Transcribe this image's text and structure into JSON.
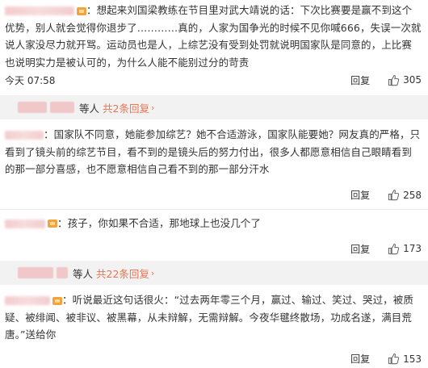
{
  "comments": [
    {
      "text": "：想起来刘国梁教练在节目里对武大靖说的话：下次比赛要是赢不到这个优势，别人就会觉得你退步了…………真的，人家为国争光的时候不见你喊666，失误一次就说人家没尽力就开骂。运动员也是人，上综艺没有受到处罚就说明国家队是同意的，上比赛也说明实力是被认可的，为什么人能不能别过分的苛责",
      "time": "今天 07:58",
      "reply": "回复",
      "likes": "305"
    },
    {
      "text": "：国家队不同意，她能参加综艺？她不合适游泳，国家队能要她？网友真的严格，只看到了镜头前的综艺节目，看不到的是镜头后的努力付出，很多人都愿意相信自己眼睛看到的那一部分喜感，也不愿意相信自己看不到的那一部分汗水",
      "time": "",
      "reply": "回复",
      "likes": "258"
    },
    {
      "text": "：孩子，你如果不合适，那地球上也没几个了",
      "time": "",
      "reply": "回复",
      "likes": "173"
    },
    {
      "text": "：听说最近这句话很火：“过去两年零三个月，赢过、输过、笑过、哭过，被质疑、被绯闻、被非议、被黑幕，从未辩解，无需辩解。今夜华毽终散场，功成名遂，满目荒唐。”送给你",
      "time": "",
      "reply": "回复",
      "likes": "153"
    }
  ],
  "expand_1": {
    "who": "等人",
    "total": "共2条回复"
  },
  "expand_2": {
    "who": "等人",
    "total": "共22条回复"
  }
}
